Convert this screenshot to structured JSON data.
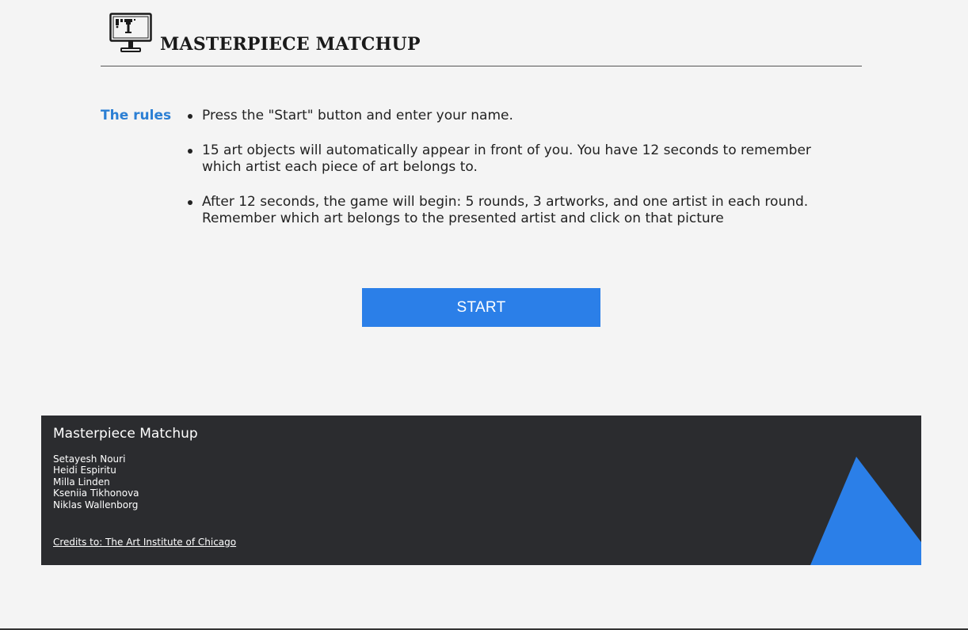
{
  "header": {
    "title": "MASTERPIECE MATCHUP",
    "logo_icon": "monitor-paintbrush-icon"
  },
  "rules": {
    "heading": "The rules",
    "items": [
      "Press the \"Start\" button and enter your name.",
      "15 art objects will automatically appear in front of you. You have 12 seconds to remember which artist each piece of art belongs to.",
      "After 12 seconds, the game will begin: 5 rounds, 3 artworks, and one artist in each round. Remember which art belongs to the presented artist and click on that picture"
    ]
  },
  "start_button": {
    "label": "START"
  },
  "footer": {
    "title": "Masterpiece Matchup",
    "members": [
      "Setayesh Nouri",
      "Heidi Espiritu",
      "Milla Linden",
      "Kseniia Tikhonova",
      "Niklas Wallenborg"
    ],
    "credits": "Credits to: The Art Institute of Chicago"
  },
  "colors": {
    "accent": "#2b7fe8",
    "rules_heading": "#2b7fd4",
    "background": "#f4f4f4",
    "footer_bg": "#2b2c2f"
  }
}
